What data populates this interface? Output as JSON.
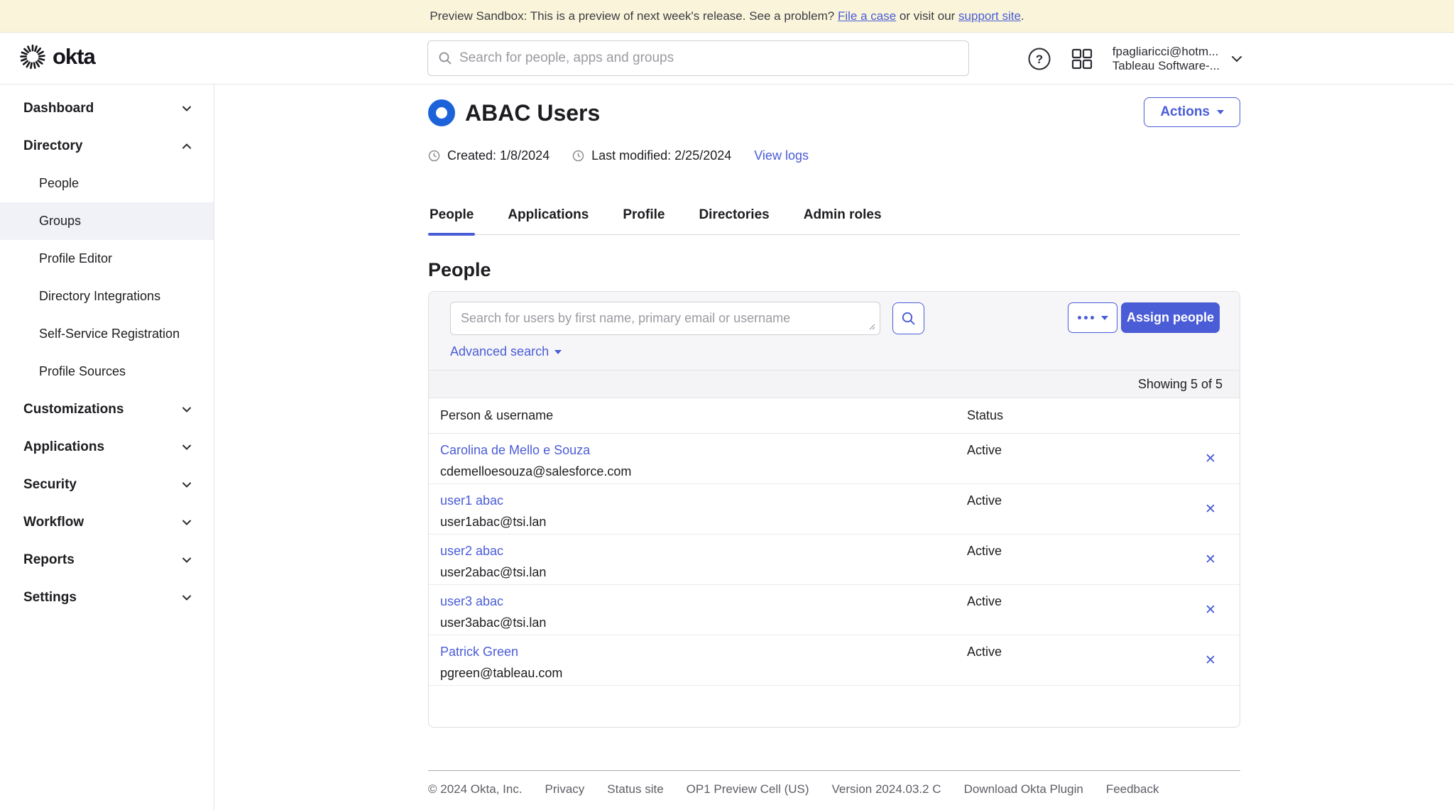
{
  "colors": {
    "accent": "#4a5cd6",
    "group_icon_blue": "#1c63d9",
    "banner_bg": "#faf5da",
    "selected_nav_bg": "#f1f2f8"
  },
  "icons": {
    "help_glyph": "?",
    "close_glyph": "✕"
  },
  "banner": {
    "text_before": "Preview Sandbox: This is a preview of next week's release. See a problem? ",
    "link_file_case": "File a case",
    "text_middle": " or visit our ",
    "link_support": "support site",
    "text_after": "."
  },
  "header": {
    "logo_text": "okta",
    "search_placeholder": "Search for people, apps and groups",
    "account_line1": "fpagliaricci@hotm...",
    "account_line2": "Tableau Software-..."
  },
  "sidebar": {
    "items": [
      {
        "label": "Dashboard",
        "type": "section"
      },
      {
        "label": "Directory",
        "type": "section",
        "expanded": true
      },
      {
        "label": "People",
        "type": "sub"
      },
      {
        "label": "Groups",
        "type": "sub",
        "selected": true
      },
      {
        "label": "Profile Editor",
        "type": "sub"
      },
      {
        "label": "Directory Integrations",
        "type": "sub"
      },
      {
        "label": "Self-Service Registration",
        "type": "sub"
      },
      {
        "label": "Profile Sources",
        "type": "sub"
      },
      {
        "label": "Customizations",
        "type": "section"
      },
      {
        "label": "Applications",
        "type": "section"
      },
      {
        "label": "Security",
        "type": "section"
      },
      {
        "label": "Workflow",
        "type": "section"
      },
      {
        "label": "Reports",
        "type": "section"
      },
      {
        "label": "Settings",
        "type": "section"
      }
    ]
  },
  "page": {
    "title": "ABAC Users",
    "actions_label": "Actions",
    "created": "Created: 1/8/2024",
    "modified": "Last modified: 2/25/2024",
    "view_logs": "View logs"
  },
  "tabs": [
    {
      "label": "People",
      "active": true
    },
    {
      "label": "Applications"
    },
    {
      "label": "Profile"
    },
    {
      "label": "Directories"
    },
    {
      "label": "Admin roles"
    }
  ],
  "people_section": {
    "heading": "People",
    "search_placeholder": "Search for users by first name, primary email or username",
    "advanced_search": "Advanced search",
    "assign_label": "Assign people",
    "showing": "Showing 5 of 5",
    "columns": {
      "person": "Person & username",
      "status": "Status"
    }
  },
  "users": [
    {
      "name": "Carolina de Mello e Souza",
      "username": "cdemelloesouza@salesforce.com",
      "status": "Active"
    },
    {
      "name": "user1 abac",
      "username": "user1abac@tsi.lan",
      "status": "Active"
    },
    {
      "name": "user2 abac",
      "username": "user2abac@tsi.lan",
      "status": "Active"
    },
    {
      "name": "user3 abac",
      "username": "user3abac@tsi.lan",
      "status": "Active"
    },
    {
      "name": "Patrick Green",
      "username": "pgreen@tableau.com",
      "status": "Active"
    }
  ],
  "footer": {
    "copyright": "© 2024 Okta, Inc.",
    "privacy": "Privacy",
    "status_site": "Status site",
    "cell": "OP1 Preview Cell (US)",
    "version": "Version 2024.03.2 C",
    "plugin": "Download Okta Plugin",
    "feedback": "Feedback"
  }
}
